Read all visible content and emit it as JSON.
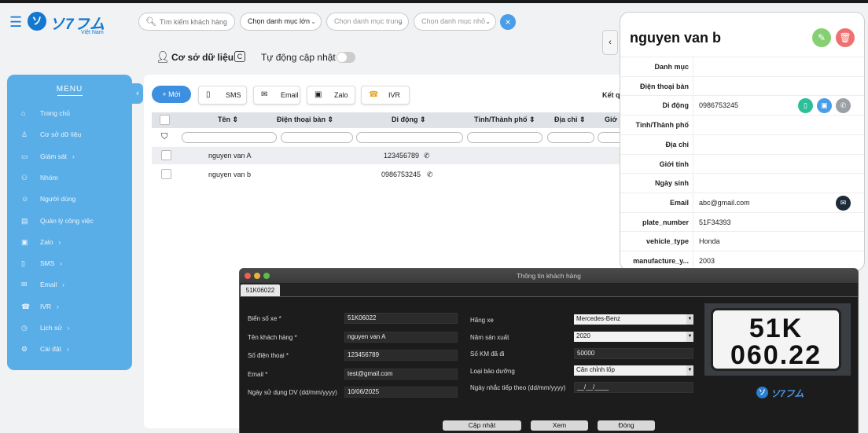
{
  "header": {
    "logo_text": "ソ7フム",
    "logo_sub": "Việt Nam",
    "search_placeholder": "Tìm kiếm khách hàng",
    "dropdown_1": "Chọn danh mục lớn",
    "dropdown_2": "Chọn danh mục trung",
    "dropdown_3": "Chọn danh mục nhỏ"
  },
  "db_bar": {
    "title": "Cơ sở dữ liệu",
    "auto_update": "Tự động cập nhật"
  },
  "sidebar": {
    "menu_title": "MENU",
    "items": [
      {
        "label": "Trang chủ",
        "icon": "home-icon",
        "arrow": ""
      },
      {
        "label": "Cơ sở dữ liệu",
        "icon": "user-icon",
        "arrow": ""
      },
      {
        "label": "Giám sát",
        "icon": "monitor-icon",
        "arrow": "›"
      },
      {
        "label": "Nhóm",
        "icon": "group-icon",
        "arrow": ""
      },
      {
        "label": "Người dùng",
        "icon": "users-icon",
        "arrow": ""
      },
      {
        "label": "Quản lý công việc",
        "icon": "task-icon",
        "arrow": ""
      },
      {
        "label": "Zalo",
        "icon": "zalo-icon",
        "arrow": "›"
      },
      {
        "label": "SMS",
        "icon": "phone-icon",
        "arrow": "›"
      },
      {
        "label": "Email",
        "icon": "mail-icon",
        "arrow": "›"
      },
      {
        "label": "IVR",
        "icon": "ivr-icon",
        "arrow": "›"
      },
      {
        "label": "Lịch sử",
        "icon": "clock-icon",
        "arrow": "›"
      },
      {
        "label": "Cài đặt",
        "icon": "gear-icon",
        "arrow": "›"
      }
    ]
  },
  "toolbar": {
    "new_label": "+ Mới",
    "sms_label": "SMS",
    "email_label": "Email",
    "zalo_label": "Zalo",
    "ivr_label": "IVR",
    "result_label": "Kết q"
  },
  "table": {
    "headers": [
      "Tên",
      "Điện thoại bàn",
      "Di động",
      "Tỉnh/Thành phố",
      "Địa chỉ",
      "Giớ"
    ],
    "rows": [
      {
        "name": "nguyen van A",
        "mobile": "123456789"
      },
      {
        "name": "nguyen van b",
        "mobile": "0986753245"
      }
    ]
  },
  "detail": {
    "title": "nguyen van b",
    "fields": [
      {
        "label": "Danh mục",
        "value": ""
      },
      {
        "label": "Điện thoại bàn",
        "value": ""
      },
      {
        "label": "Di động",
        "value": "0986753245"
      },
      {
        "label": "Tỉnh/Thành phố",
        "value": ""
      },
      {
        "label": "Địa chỉ",
        "value": ""
      },
      {
        "label": "Giới tính",
        "value": ""
      },
      {
        "label": "Ngày sinh",
        "value": ""
      },
      {
        "label": "Email",
        "value": "abc@gmail.com"
      },
      {
        "label": "plate_number",
        "value": "51F34393"
      },
      {
        "label": "vehicle_type",
        "value": "Honda"
      },
      {
        "label": "manufacture_y...",
        "value": "2003"
      }
    ]
  },
  "dialog": {
    "title": "Thông tin khách hàng",
    "tab": "51K06022",
    "left_fields": [
      {
        "label": "Biển số xe *",
        "value": "51K06022"
      },
      {
        "label": "Tên khách hàng *",
        "value": "nguyen van A"
      },
      {
        "label": "Số điện thoại *",
        "value": "123456789"
      },
      {
        "label": "Email *",
        "value": "test@gmail.com"
      },
      {
        "label": "Ngày sử dụng DV (dd/mm/yyyy)",
        "value": "10/06/2025"
      }
    ],
    "right_fields": [
      {
        "label": "Hãng xe",
        "value": "Mercedes-Benz"
      },
      {
        "label": "Năm sản xuất",
        "value": "2020"
      },
      {
        "label": "Số KM đã đi",
        "value": "50000"
      },
      {
        "label": "Loại bảo dưỡng",
        "value": "Căn chỉnh lốp"
      },
      {
        "label": "Ngày nhắc tiếp theo (dd/mm/yyyy)",
        "value": "__/__/____"
      }
    ],
    "plate_line1": "51K",
    "plate_line2": "060.22",
    "logo_text": "ソ7フム",
    "btn_update": "Cập nhật",
    "btn_view": "Xem",
    "btn_close": "Đóng"
  },
  "colors": {
    "accent": "#3d8fe0",
    "sidebar": "#5aaee8",
    "edit": "#86d073",
    "delete": "#ef7070"
  }
}
